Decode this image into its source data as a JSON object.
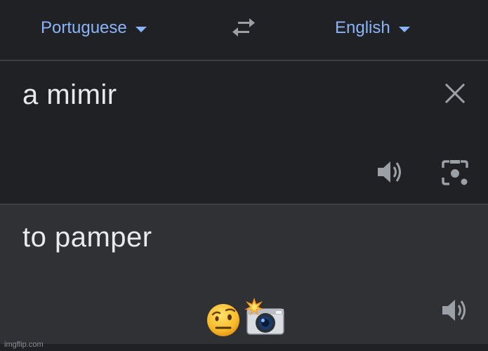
{
  "language_bar": {
    "source_language": "Portuguese",
    "target_language": "English",
    "swap_icon": "swap-arrows-icon",
    "accent_color": "#8ab4f8"
  },
  "source": {
    "text": "a mimir",
    "clear_icon": "close-icon",
    "speak_icon": "speaker-icon",
    "camera_icon": "camera-lens-icon"
  },
  "translation": {
    "text": "to pamper",
    "speak_icon": "speaker-icon",
    "overlay_emojis": [
      "raised-eyebrow-face-emoji",
      "camera-with-flash-emoji"
    ]
  },
  "watermark": "imgflip.com"
}
